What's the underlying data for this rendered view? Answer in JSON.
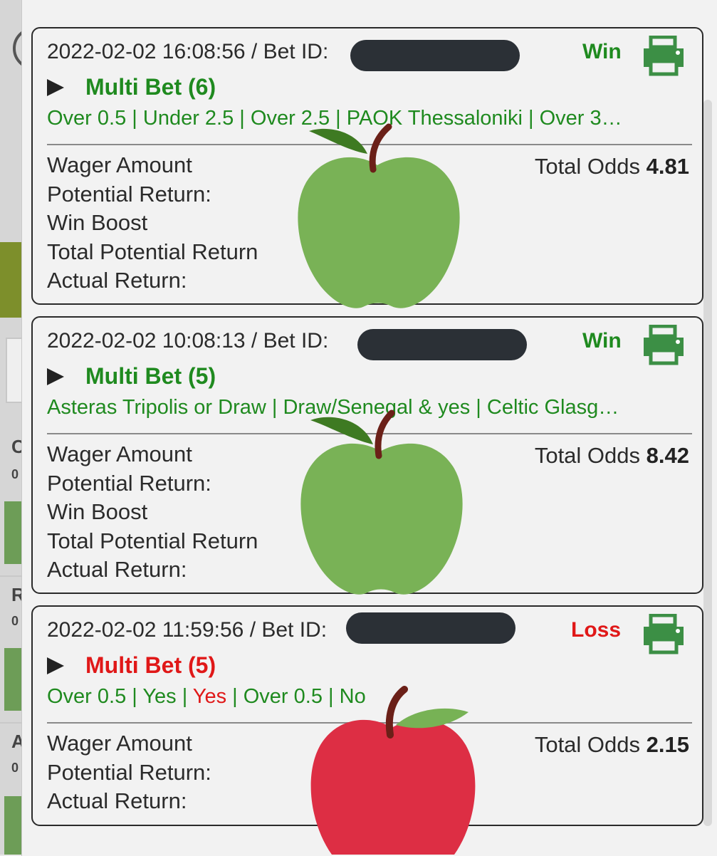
{
  "colors": {
    "win": "#1f8a1f",
    "loss": "#e01818",
    "redaction": "#2b3036"
  },
  "background": {
    "letters": [
      {
        "text": "C",
        "sub": "0"
      },
      {
        "text": "R",
        "sub": "0"
      },
      {
        "text": "A",
        "sub": "0"
      }
    ]
  },
  "bets": [
    {
      "datetime": "2022-02-02 16:08:56",
      "bet_id_label": "/ Bet ID:",
      "status": "Win",
      "title": "Multi Bet (6)",
      "selections": [
        {
          "text": "Over 0.5",
          "result": "win"
        },
        {
          "text": "Under 2.5",
          "result": "win"
        },
        {
          "text": "Over 2.5",
          "result": "win"
        },
        {
          "text": "PAOK Thessaloniki",
          "result": "win"
        },
        {
          "text": "Over 3…",
          "result": "win"
        }
      ],
      "details": [
        "Wager Amount",
        "Potential Return:",
        "Win Boost",
        "Total Potential Return",
        "Actual Return:"
      ],
      "odds_label": "Total Odds",
      "odds_value": "4.81",
      "overlay": "green-apple-icon"
    },
    {
      "datetime": "2022-02-02 10:08:13",
      "bet_id_label": "/ Bet ID:",
      "status": "Win",
      "title": "Multi Bet (5)",
      "selections": [
        {
          "text": "Asteras Tripolis or Draw",
          "result": "win"
        },
        {
          "text": "Draw/Senegal & yes",
          "result": "win"
        },
        {
          "text": "Celtic Glasg…",
          "result": "win"
        }
      ],
      "details": [
        "Wager Amount",
        "Potential Return:",
        "Win Boost",
        "Total Potential Return",
        "Actual Return:"
      ],
      "odds_label": "Total Odds",
      "odds_value": "8.42",
      "overlay": "green-apple-icon"
    },
    {
      "datetime": "2022-02-02 11:59:56",
      "bet_id_label": "/ Bet ID:",
      "status": "Loss",
      "title": "Multi Bet (5)",
      "selections": [
        {
          "text": "Over 0.5",
          "result": "win"
        },
        {
          "text": "Yes",
          "result": "win"
        },
        {
          "text": "Yes",
          "result": "loss"
        },
        {
          "text": "Over 0.5",
          "result": "win"
        },
        {
          "text": "No",
          "result": "win"
        }
      ],
      "details": [
        "Wager Amount",
        "Potential Return:",
        "Actual Return:"
      ],
      "odds_label": "Total Odds",
      "odds_value": "2.15",
      "overlay": "red-apple-icon"
    }
  ]
}
